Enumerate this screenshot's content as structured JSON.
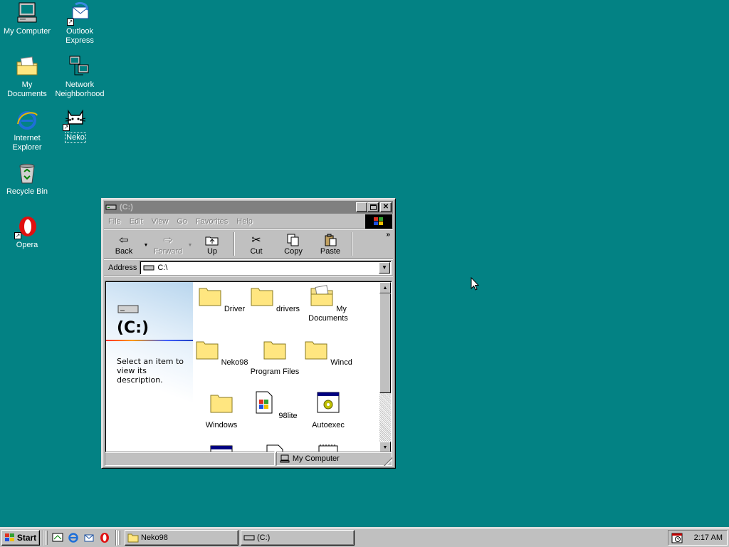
{
  "desktop": {
    "icons": [
      {
        "label": "My Computer"
      },
      {
        "label": "Outlook Express"
      },
      {
        "label": "My Documents"
      },
      {
        "label": "Network Neighborhood"
      },
      {
        "label": "Internet Explorer"
      },
      {
        "label": "Neko"
      },
      {
        "label": "Recycle Bin"
      },
      {
        "label": "Opera"
      }
    ]
  },
  "window": {
    "title": "(C:)",
    "menu": [
      "File",
      "Edit",
      "View",
      "Go",
      "Favorites",
      "Help"
    ],
    "toolbar": {
      "back": "Back",
      "forward": "Forward",
      "up": "Up",
      "cut": "Cut",
      "copy": "Copy",
      "paste": "Paste",
      "more": "»"
    },
    "address": {
      "label": "Address",
      "value": "C:\\"
    },
    "webview": {
      "title": "(C:)",
      "description": "Select an item to view its description."
    },
    "files": [
      {
        "name": "Driver",
        "icon": "folder-icon"
      },
      {
        "name": "drivers",
        "icon": "folder-icon"
      },
      {
        "name": "My Documents",
        "icon": "my-documents-folder-icon"
      },
      {
        "name": "Neko98",
        "icon": "folder-icon"
      },
      {
        "name": "Program Files",
        "icon": "folder-icon"
      },
      {
        "name": "Wincd",
        "icon": "folder-icon"
      },
      {
        "name": "Windows",
        "icon": "folder-icon"
      },
      {
        "name": "98lite",
        "icon": "document-icon"
      },
      {
        "name": "Autoexec",
        "icon": "batch-file-icon"
      }
    ],
    "status": {
      "location": "My Computer"
    }
  },
  "taskbar": {
    "start": "Start",
    "tasks": [
      {
        "label": "Neko98"
      },
      {
        "label": "(C:)"
      }
    ],
    "clock": "2:17 AM"
  },
  "colors": {
    "desktop": "#038284",
    "titlebar_inactive": "#808080",
    "face": "#c0c0c0"
  }
}
